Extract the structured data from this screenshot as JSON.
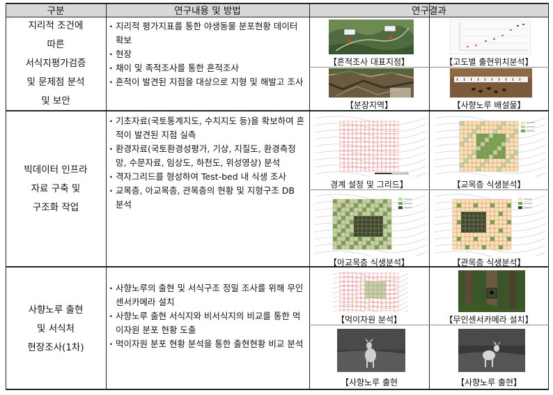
{
  "headers": [
    "구분",
    "연구내용 및 방법",
    "연구결과"
  ],
  "rows": [
    {
      "category_lines": [
        "지리적 조건에",
        "따른",
        "서식지평가검증",
        "및 문제점 분석",
        "및 보안"
      ],
      "bullets": [
        "지리적 평가지표를 통한 야생동물 분포현황 데이터 확보",
        "현장",
        "채이 및 족적조사를 통한 흔적조사",
        "흔적이 발견된 지점을 대상으로 지형 및 해발고 조사"
      ],
      "figures": [
        {
          "caption": "【흔적조사 대표지점】",
          "icon": "satellite-map-photo"
        },
        {
          "caption": "【고도별 출현위치분석】",
          "icon": "elevation-scatter-chart"
        },
        {
          "caption": "【분장지역】",
          "icon": "forest-floor-photo"
        },
        {
          "caption": "【사향노루 배설물】",
          "icon": "droppings-photo"
        }
      ]
    },
    {
      "category_lines": [
        "빅데이터 인프라",
        "자료 구축 및",
        "구조화 작업"
      ],
      "bullets": [
        "기초자료(국토통계지도, 수치지도 등)을 확보하여 흔적이 발견된 지점 실측",
        "환경자료(국토환경성평가, 기상, 지질도, 환경측정망, 수문자료, 임상도, 하천도, 위성영상) 분석",
        "격자그리드를 형성하여 Test-bed 내 식생 조사",
        "교목층, 아교목층, 관목층의 현황 및 지형구조 DB 분석"
      ],
      "figures": [
        {
          "caption": "경계 설정 및 그리드】",
          "icon": "contour-grid-map"
        },
        {
          "caption": "【교목층 식생분석】",
          "icon": "tree-layer-map"
        },
        {
          "caption": "【아교목층 식생분석】",
          "icon": "subtree-layer-map"
        },
        {
          "caption": "【관목층 식생분석】",
          "icon": "shrub-layer-map"
        }
      ]
    },
    {
      "category_lines": [
        "사향노루 출현",
        "및 서식처",
        "현장조사(1차)"
      ],
      "bullets": [
        "사향노루의 출현 및 서식구조 정밀 조사를 위해 무인센서카메라 설치",
        "사향노루 출현 서식지와 비서식지의 비교를 통한 먹이자원 분포 현황 도출",
        "먹이자원 분포 현황 분석을 통한 출현현황 비교 분석"
      ],
      "figures": [
        {
          "caption": "【먹이자원 분석】",
          "icon": "food-resource-map"
        },
        {
          "caption": "【무인센서카메라 설치】",
          "icon": "camera-tree-photo"
        },
        {
          "caption": "【사향노루 출현",
          "icon": "night-camera-deer-photo"
        },
        {
          "caption": "【사향노루 출현】",
          "icon": "night-camera-deer-photo"
        }
      ]
    }
  ],
  "colors": {
    "header_bg": "#d8d8d8",
    "grid_line": "#e57373",
    "veg_dark": "#2f4f2f",
    "veg_mid": "#6aa84f",
    "veg_light": "#b6d7a8",
    "veg_pale": "#f2e6b5"
  }
}
